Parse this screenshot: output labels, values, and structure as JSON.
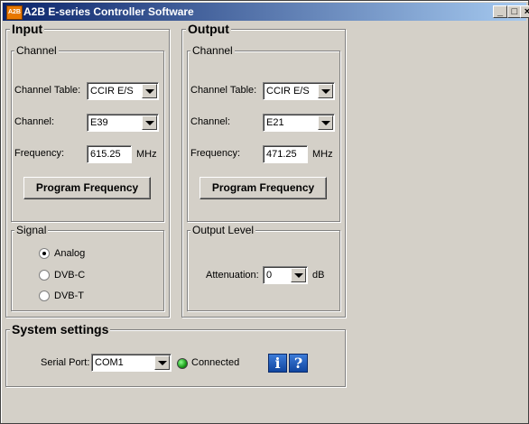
{
  "window": {
    "app_icon_text": "A2B",
    "title": "A2B E-series Controller Software",
    "minimize": "_",
    "maximize": "□",
    "close": "×"
  },
  "input": {
    "title": "Input",
    "channel_group": "Channel",
    "channel_table_label": "Channel Table:",
    "channel_table_value": "CCIR E/S",
    "channel_label": "Channel:",
    "channel_value": "E39",
    "frequency_label": "Frequency:",
    "frequency_value": "615.25",
    "frequency_unit": "MHz",
    "program_button": "Program Frequency",
    "signal_group": "Signal",
    "signal_options": [
      {
        "label": "Analog",
        "selected": true
      },
      {
        "label": "DVB-C",
        "selected": false
      },
      {
        "label": "DVB-T",
        "selected": false
      }
    ]
  },
  "output": {
    "title": "Output",
    "channel_group": "Channel",
    "channel_table_label": "Channel Table:",
    "channel_table_value": "CCIR E/S",
    "channel_label": "Channel:",
    "channel_value": "E21",
    "frequency_label": "Frequency:",
    "frequency_value": "471.25",
    "frequency_unit": "MHz",
    "program_button": "Program Frequency",
    "level_group": "Output Level",
    "attenuation_label": "Attenuation:",
    "attenuation_value": "0",
    "attenuation_unit": "dB"
  },
  "system": {
    "title": "System settings",
    "serial_port_label": "Serial Port:",
    "serial_port_value": "COM1",
    "status": "Connected",
    "status_color": "#22b022",
    "info_icon": "info-icon",
    "help_icon": "help-icon",
    "info_glyph": "i",
    "help_glyph": "?"
  }
}
